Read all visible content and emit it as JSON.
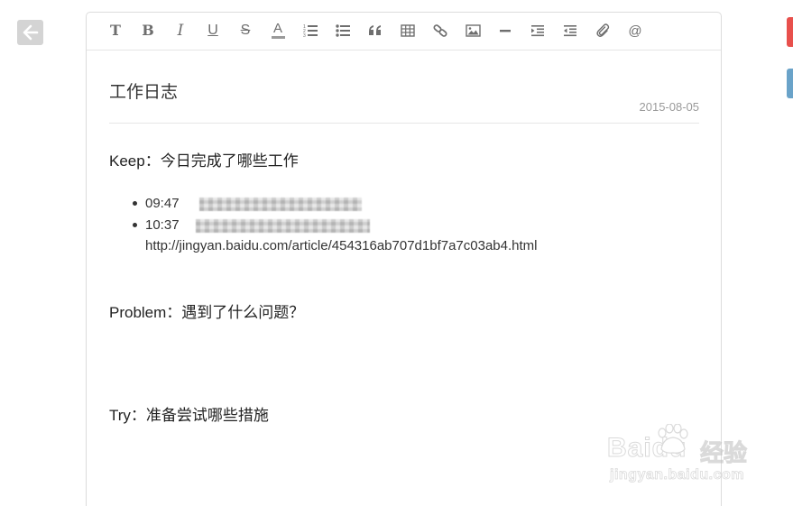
{
  "app": {
    "back_icon": "arrow-left-icon",
    "side_tab_colors": [
      "#e8504c",
      "#6aa3c9"
    ]
  },
  "toolbar": {
    "buttons": [
      {
        "name": "heading",
        "glyph": "T",
        "icon": "text-heading-icon"
      },
      {
        "name": "bold",
        "glyph": "B",
        "icon": "bold-icon"
      },
      {
        "name": "italic",
        "glyph": "I",
        "icon": "italic-icon"
      },
      {
        "name": "underline",
        "glyph": "U",
        "icon": "underline-icon"
      },
      {
        "name": "strikethrough",
        "glyph": "S",
        "icon": "strikethrough-icon"
      },
      {
        "name": "font-color",
        "glyph": "A",
        "icon": "font-color-icon"
      },
      {
        "name": "ordered-list",
        "icon": "ordered-list-icon"
      },
      {
        "name": "unordered-list",
        "icon": "unordered-list-icon"
      },
      {
        "name": "blockquote",
        "icon": "quote-icon"
      },
      {
        "name": "table",
        "icon": "table-icon"
      },
      {
        "name": "link",
        "icon": "link-icon"
      },
      {
        "name": "image",
        "icon": "image-icon"
      },
      {
        "name": "horizontal-rule",
        "icon": "horizontal-rule-icon"
      },
      {
        "name": "indent",
        "icon": "indent-icon"
      },
      {
        "name": "outdent",
        "icon": "outdent-icon"
      },
      {
        "name": "attachment",
        "icon": "paperclip-icon"
      },
      {
        "name": "mention",
        "glyph": "@",
        "icon": "at-icon"
      }
    ]
  },
  "document": {
    "title": "工作日志",
    "date": "2015-08-05",
    "sections": {
      "keep": "Keep：今日完成了哪些工作",
      "problem": "Problem：遇到了什么问题？",
      "try": "Try：准备尝试哪些措施"
    },
    "entries": [
      {
        "time": "09:47"
      },
      {
        "time": "10:37",
        "url": "http://jingyan.baidu.com/article/454316ab707d1bf7a7c03ab4.html"
      }
    ]
  },
  "watermark": {
    "brand": "Baidu",
    "cn": "经验",
    "url": "jingyan.baidu.com"
  }
}
